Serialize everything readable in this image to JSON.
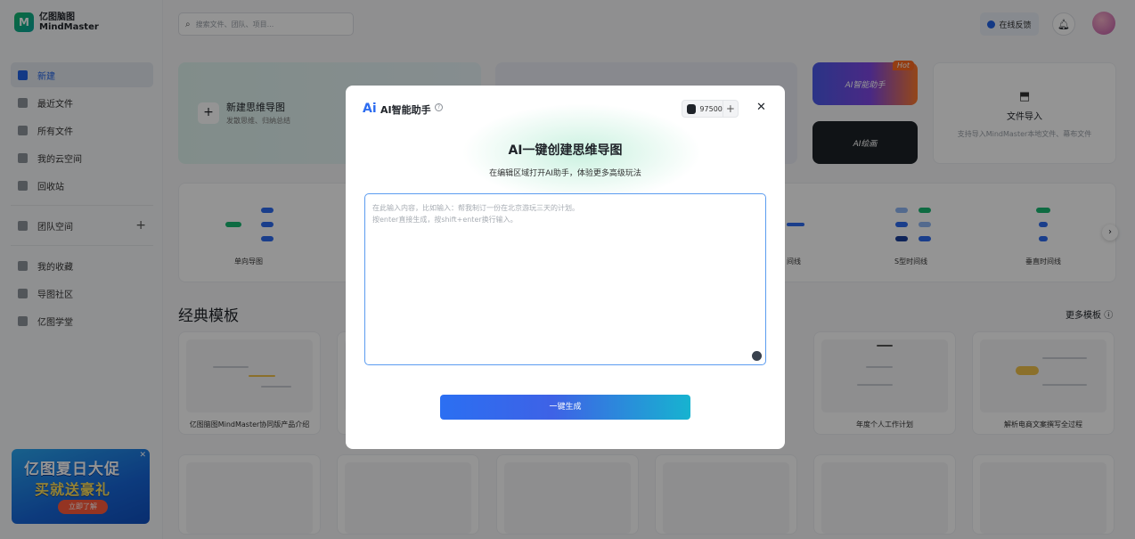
{
  "app": {
    "logo_line1": "亿图脑图",
    "logo_line2": "MindMaster"
  },
  "sidebar": {
    "items": [
      {
        "label": "新建",
        "active": true
      },
      {
        "label": "最近文件"
      },
      {
        "label": "所有文件"
      },
      {
        "label": "我的云空间"
      },
      {
        "label": "回收站"
      }
    ],
    "team_label": "团队空间",
    "items2": [
      {
        "label": "我的收藏"
      },
      {
        "label": "导图社区"
      },
      {
        "label": "亿图学堂"
      }
    ],
    "promo": {
      "line1": "亿图夏日大促",
      "line2": "买就送豪礼",
      "button": "立即了解"
    }
  },
  "topbar": {
    "search_placeholder": "搜索文件、团队、项目...",
    "feedback": "在线反馈"
  },
  "cards": {
    "new_title": "新建思维导图",
    "new_sub": "发散思维、归纳总结",
    "ai_assistant": "AI智能助手",
    "hot": "Hot",
    "ai_draw": "AI绘画",
    "import_title": "文件导入",
    "import_sub": "支持导入MindMaster本地文件、幕布文件"
  },
  "types": [
    {
      "label": "单向导图"
    },
    {
      "label": "间线"
    },
    {
      "label": "S型时间线"
    },
    {
      "label": "垂直时间线"
    }
  ],
  "templates": {
    "section_title": "经典模板",
    "more": "更多模板",
    "items": [
      {
        "label": "亿图脑图MindMaster协同版产品介绍"
      },
      {
        "label": "年度个人工作计划"
      },
      {
        "label": "解析电商文案撰写全过程"
      }
    ]
  },
  "modal": {
    "logo": "Ai",
    "title": "AI智能助手",
    "credits": "97500",
    "heading": "AI一键创建思维导图",
    "subheading": "在编辑区域打开AI助手，体验更多高级玩法",
    "placeholder_line1": "在此输入内容，比如输入：帮我制订一份在北京游玩三天的计划。",
    "placeholder_line2": "按enter直接生成，按shift+enter换行输入。",
    "generate_button": "一键生成"
  },
  "colors": {
    "accent": "#2163e5",
    "brand_green": "#14b86a"
  }
}
